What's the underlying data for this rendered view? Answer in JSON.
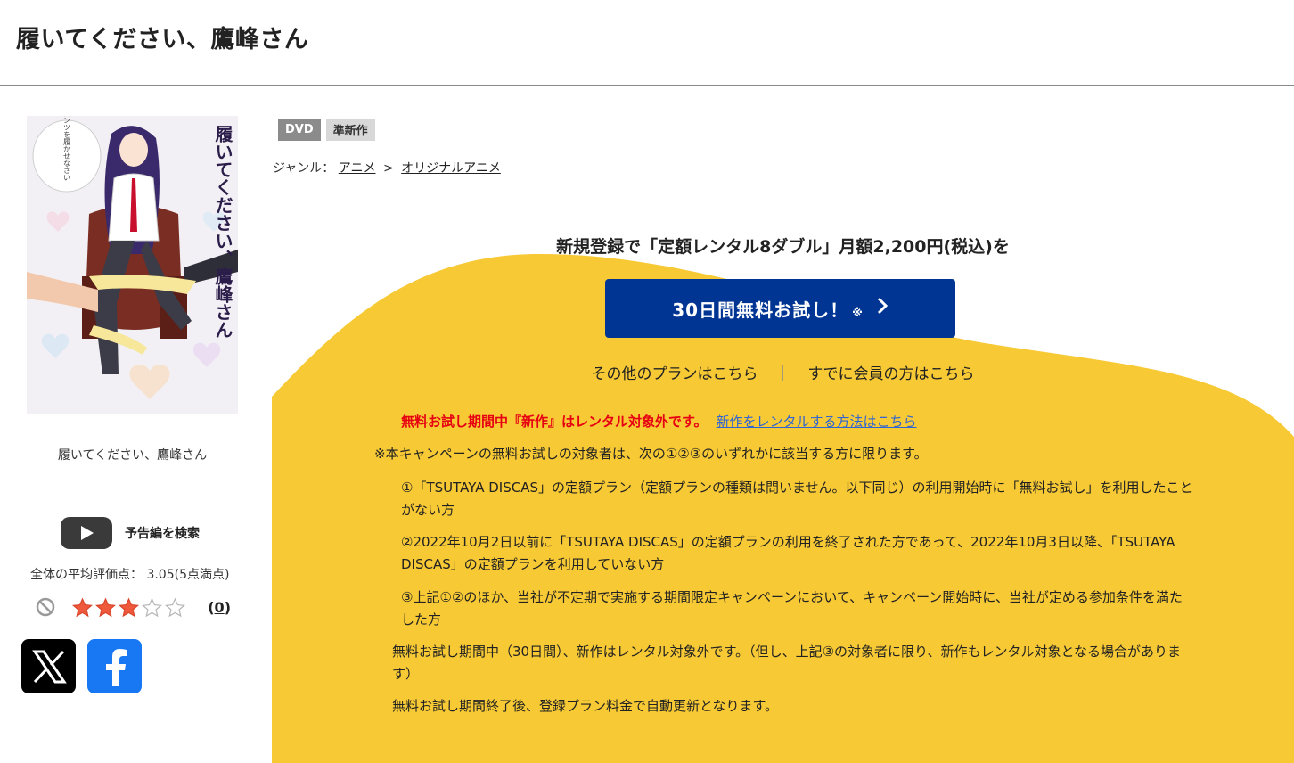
{
  "title": "履いてください、鷹峰さん",
  "cover": {
    "title_art": "履いてください、鷹峰さん",
    "tagline": "私にパンツを履かせなさい"
  },
  "sidebar": {
    "caption": "履いてください、鷹峰さん",
    "trailer_label": "予告編を検索",
    "avg_rating_text": "全体の平均評価点： 3.05(5点満点)",
    "rating_value": 3.05,
    "rating_max": 5,
    "review_open": "(",
    "review_count": "0",
    "review_close": ")"
  },
  "badges": {
    "dvd": "DVD",
    "semi_new": "準新作"
  },
  "genre": {
    "label": "ジャンル：",
    "items": [
      "アニメ",
      "オリジナルアニメ"
    ],
    "separator": ">"
  },
  "promo": {
    "headline": "新規登録で「定額レンタル8ダブル」月額2,200円(税込)を",
    "cta_label": "30日間無料お試し！",
    "cta_note": "※",
    "other_plans": "その他のプランはこちら",
    "divider": "｜",
    "member_link": "すでに会員の方はこちら",
    "notice_warning": "無料お試し期間中『新作』はレンタル対象外です。",
    "notice_link": "新作をレンタルする方法はこちら",
    "terms_intro": "※本キャンペーンの無料お試しの対象者は、次の①②③のいずれかに該当する方に限ります。",
    "term1": "①「TSUTAYA DISCAS」の定額プラン（定額プランの種類は問いません。以下同じ）の利用開始時に「無料お試し」を利用したことがない方",
    "term2": "②2022年10月2日以前に「TSUTAYA DISCAS」の定額プランの利用を終了された方であって、2022年10月3日以降、「TSUTAYA DISCAS」の定額プランを利用していない方",
    "term3": "③上記①②のほか、当社が不定期で実施する期間限定キャンペーンにおいて、キャンペーン開始時に、当社が定める参加条件を満たした方",
    "term4": "無料お試し期間中（30日間）、新作はレンタル対象外です。（但し、上記③の対象者に限り、新作もレンタル対象となる場合があります）",
    "term5": "無料お試し期間終了後、登録プラン料金で自動更新となります。"
  },
  "colors": {
    "promo_bg": "#f7c935",
    "cta_bg": "#003594",
    "warning": "#e60012",
    "link": "#2f64d3",
    "x_bg": "#000000",
    "fb_bg": "#1877f2"
  },
  "icons": [
    "youtube-play-icon",
    "no-entry-icon",
    "star-icon",
    "x-logo-icon",
    "facebook-logo-icon",
    "chevron-right-icon"
  ]
}
